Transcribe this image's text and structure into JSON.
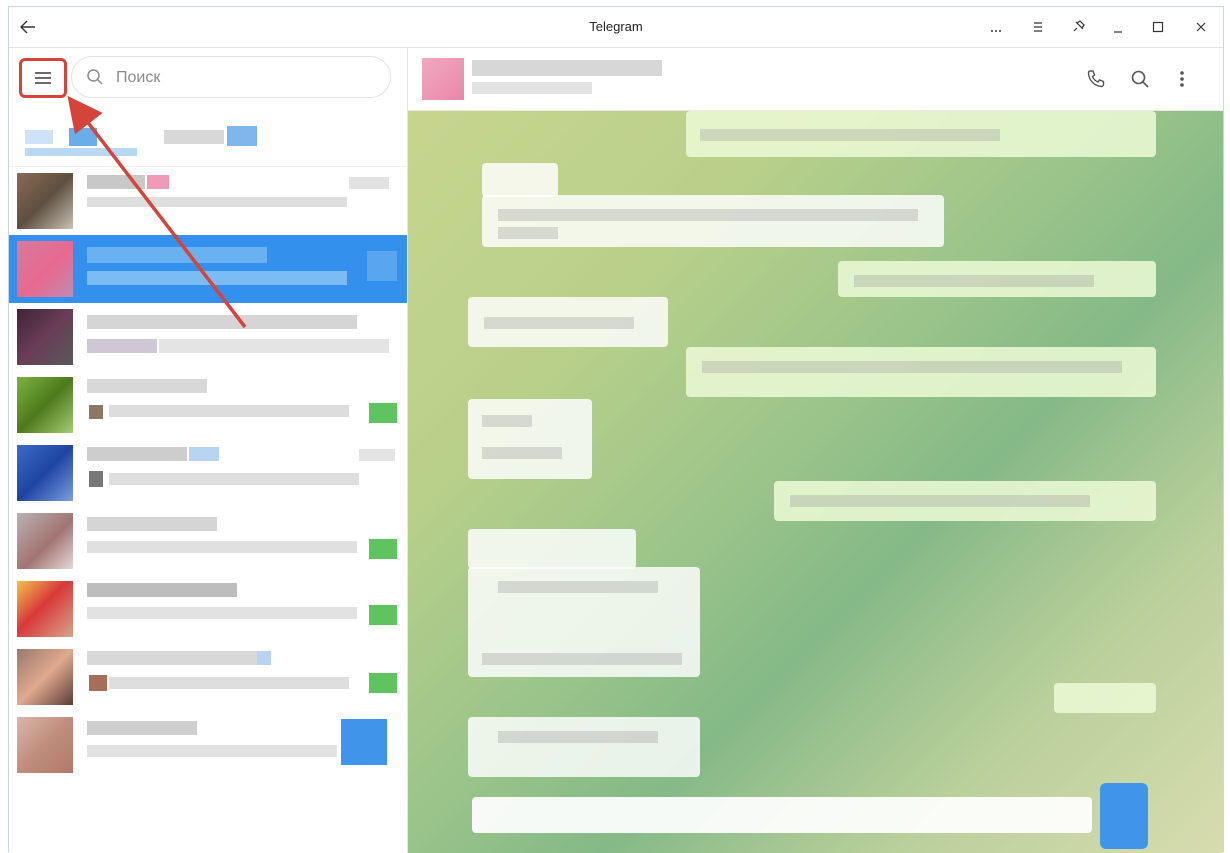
{
  "window": {
    "title": "Telegram",
    "back_icon": "arrow-left-icon",
    "controls": [
      "more-icon",
      "menu-lines-icon",
      "pin-icon",
      "minimize-icon",
      "maximize-icon",
      "close-icon"
    ]
  },
  "sidebar": {
    "menu_icon": "hamburger-menu-icon",
    "search": {
      "placeholder": "Поиск",
      "value": ""
    }
  },
  "chat_header": {
    "actions": [
      "phone-icon",
      "search-icon",
      "kebab-more-icon"
    ]
  },
  "colors": {
    "accent": "#3390ec",
    "annotation": "#d6433a",
    "unread_badge": "#5fc35f"
  }
}
